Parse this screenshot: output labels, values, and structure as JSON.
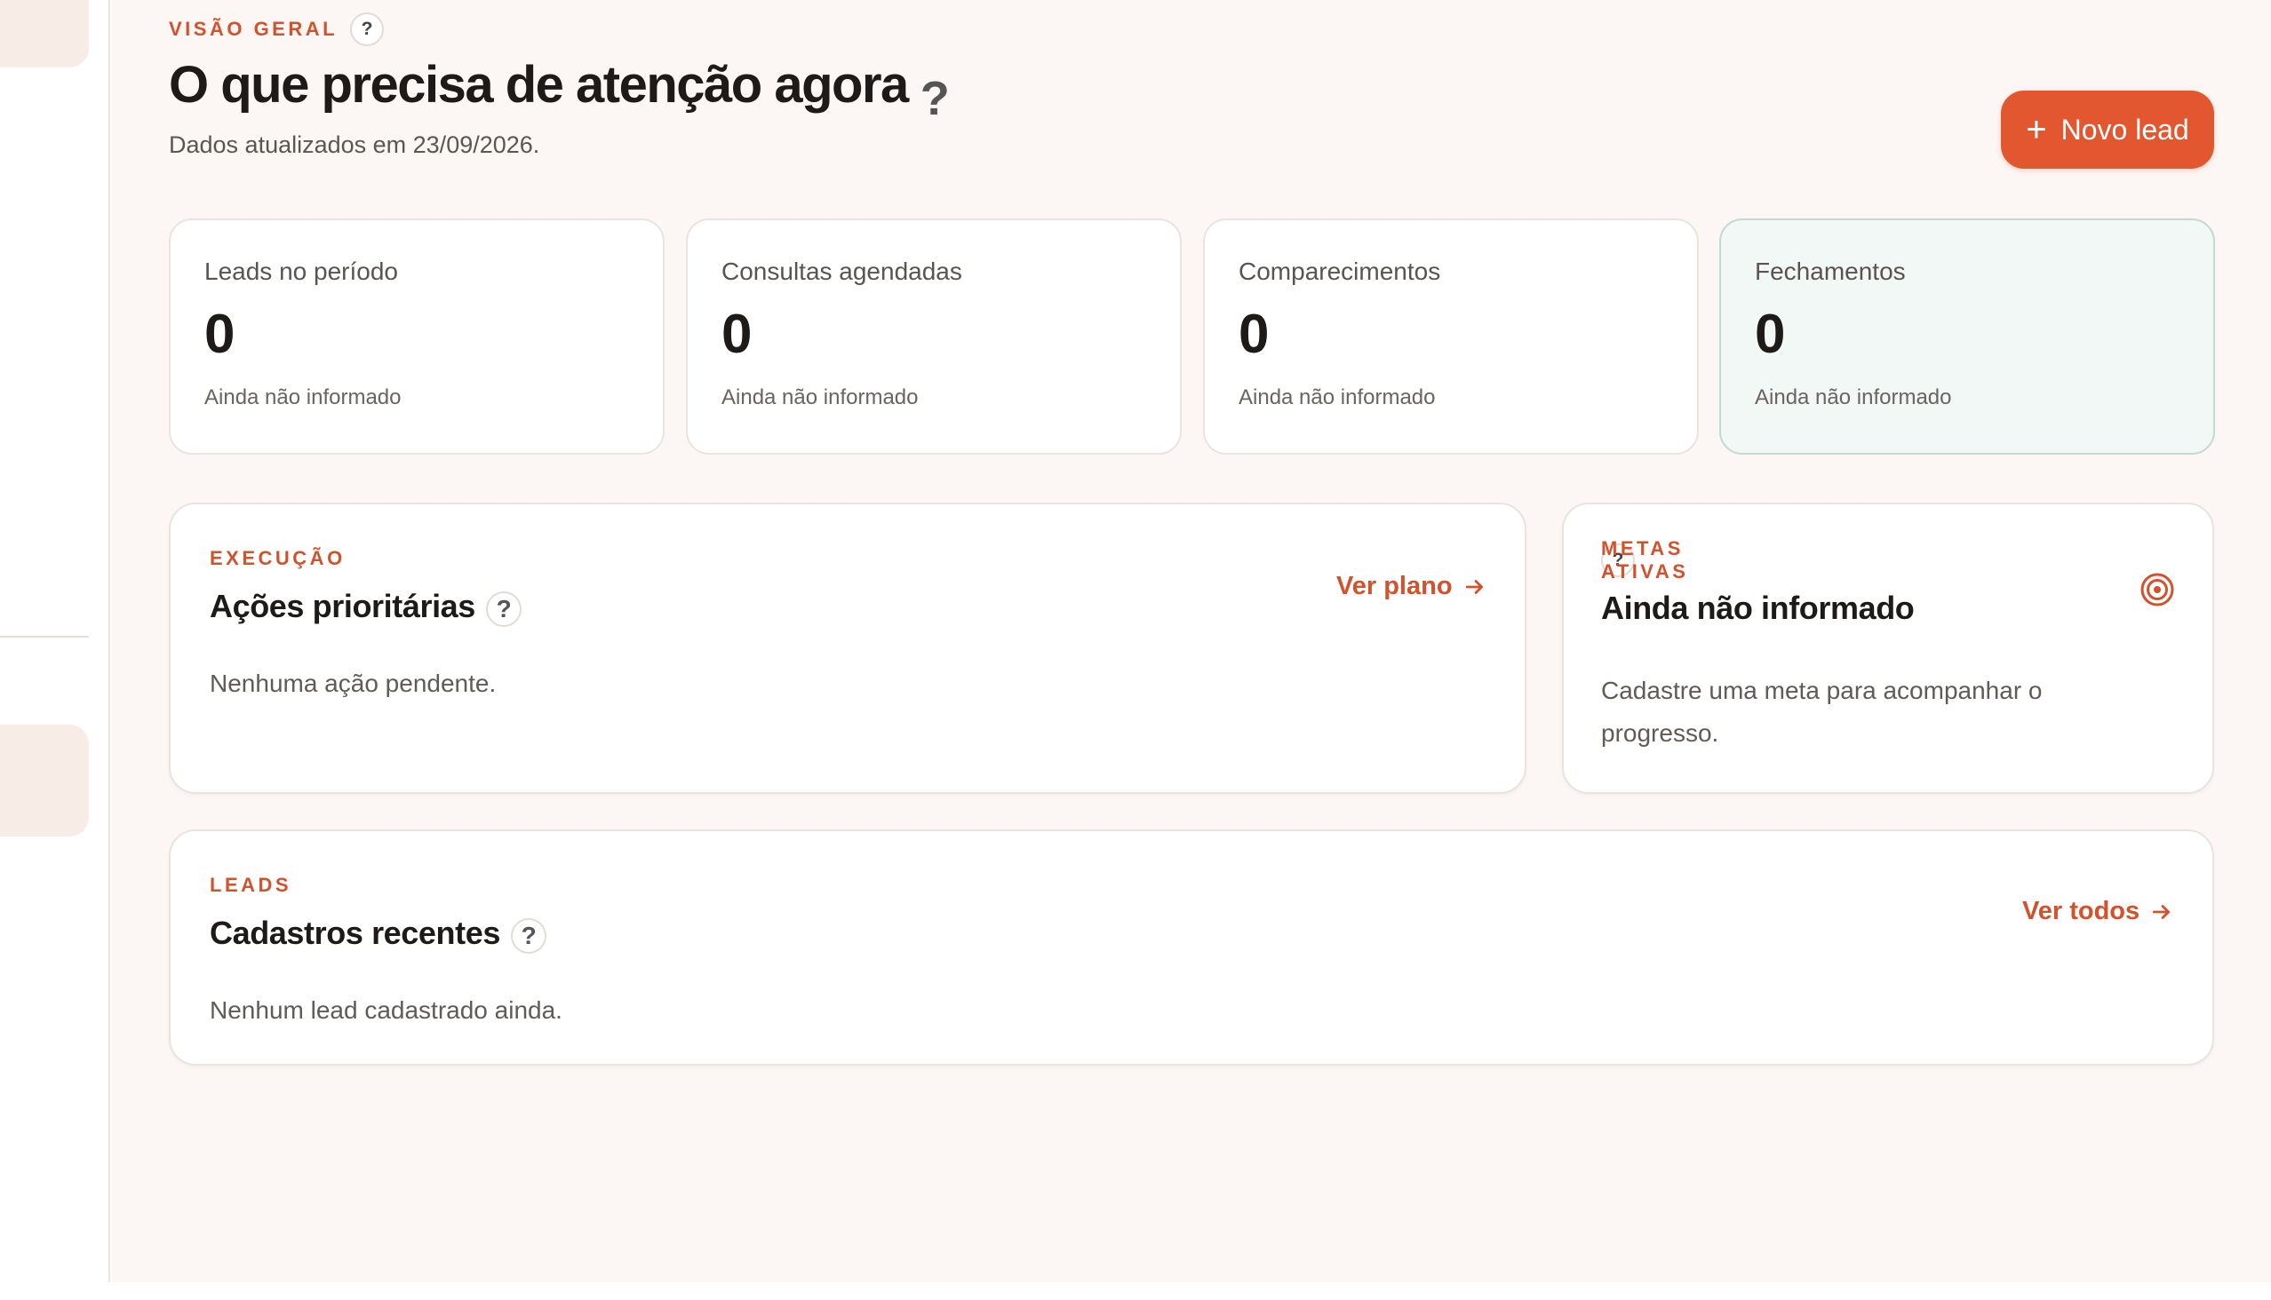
{
  "sidebar": {},
  "header": {
    "eyebrow": "VISÃO GERAL",
    "title": "O que precisa de atenção agora",
    "help": "?",
    "subtitle": "Dados atualizados em 23/09/2026."
  },
  "actions": {
    "new_lead": "Novo lead",
    "new_lead_icon": "+"
  },
  "metrics": [
    {
      "label": "Leads no período",
      "value": "0",
      "note": "Ainda não informado"
    },
    {
      "label": "Consultas agendadas",
      "value": "0",
      "note": "Ainda não informado"
    },
    {
      "label": "Comparecimentos",
      "value": "0",
      "note": "Ainda não informado"
    },
    {
      "label": "Fechamentos",
      "value": "0",
      "note": "Ainda não informado"
    }
  ],
  "execution": {
    "eyebrow": "EXECUÇÃO",
    "title": "Ações prioritárias",
    "empty": "Nenhuma ação pendente.",
    "link": "Ver plano"
  },
  "goals": {
    "eyebrow": "METAS ATIVAS",
    "title": "Ainda não informado",
    "body": "Cadastre uma meta para acompanhar o progresso.",
    "icon": "target-icon"
  },
  "leads": {
    "eyebrow": "LEADS",
    "title": "Cadastros recentes",
    "empty": "Nenhum lead cadastrado ainda.",
    "link": "Ver todos"
  },
  "colors": {
    "accent": "#d2522d",
    "button": "#e2572f",
    "background": "#fcf7f4",
    "highlight_card": "#f2f8f5"
  }
}
